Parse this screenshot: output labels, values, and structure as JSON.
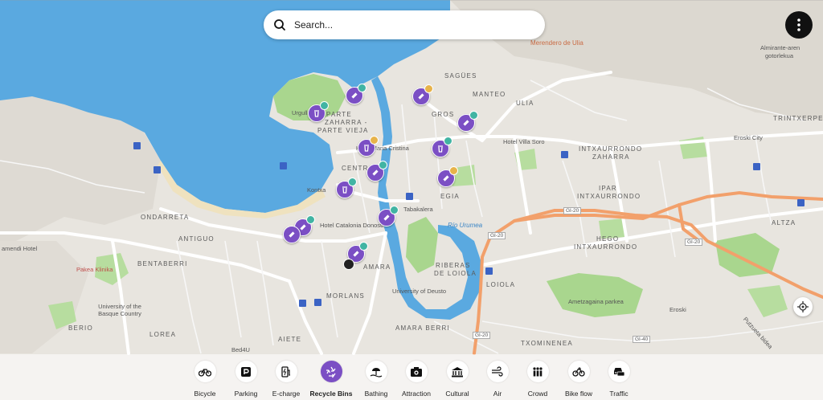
{
  "search": {
    "placeholder": "Search..."
  },
  "map": {
    "labels": {
      "saguees": "SAGÜES",
      "manteo": "MANTEO",
      "ulia": "ULIA",
      "gros": "GROS",
      "parte_zaharra_1": "PARTE",
      "parte_zaharra_2": "ZAHARRA -",
      "parte_zaharra_3": "PARTE VIEJA",
      "urgull": "Urgull",
      "centro": "CENTRO",
      "maria_cristina": "Hotel Maria Cristina",
      "kontxa": "Kontxa",
      "egia": "EGIA",
      "tabakalera": "Tabakalera",
      "catalonia": "Hotel Catalonia Donosti",
      "ondarreta": "ONDARRETA",
      "antiguo": "ANTIGUO",
      "amendi": "amendi Hotel",
      "bentaberri": "BENTABERRI",
      "pakea": "Pakea Klinika",
      "univ_basque": "University of the Basque Country",
      "berio": "BERIO",
      "lorea": "LOREA",
      "bed4u": "Bed4U",
      "aiete": "AIETE",
      "amara": "AMARA",
      "morlans": "MORLANS",
      "amara_berri": "AMARA BERRI",
      "riberas": "RIBERAS",
      "de_loiola": "DE LOIOLA",
      "loiola": "LOIOLA",
      "deusto": "University of Deusto",
      "rio_urumea": "Río Urumea",
      "txominenea": "TXOMINENEA",
      "intxaurrondo_z": "INTXAURRONDO",
      "zaharra": "ZAHARRA",
      "ipar": "IPAR",
      "intx": "INTXAURRONDO",
      "hego": "HEGO",
      "intx2": "INTXAURRONDO",
      "villa_soro": "Hotel Villa Soro",
      "eroski_city": "Eroski City",
      "trintxerpe": "TRINTXERPE",
      "altza": "ALTZA",
      "ametzagaina": "Ametzagaina parkea",
      "eroski": "Eroski",
      "merendero": "Merendero de Ulia",
      "almirante": "Almirante-aren",
      "gotorlekua": "gotorlekua",
      "putzueta": "Putzueta bidea",
      "gi20_a": "GI-20",
      "gi20_b": "GI-20",
      "gi20_c": "GI-20",
      "gi20_d": "GI-20",
      "gi40": "GI-40"
    }
  },
  "categories": [
    {
      "name": "Bicycle",
      "icon": "bicycle-icon"
    },
    {
      "name": "Parking",
      "icon": "parking-icon"
    },
    {
      "name": "E-charge",
      "icon": "charging-station-icon"
    },
    {
      "name": "Recycle Bins",
      "icon": "recycle-icon",
      "active": true
    },
    {
      "name": "Bathing",
      "icon": "beach-icon"
    },
    {
      "name": "Attraction",
      "icon": "camera-icon"
    },
    {
      "name": "Cultural",
      "icon": "museum-icon"
    },
    {
      "name": "Air",
      "icon": "wind-icon"
    },
    {
      "name": "Crowd",
      "icon": "crowd-icon"
    },
    {
      "name": "Bike flow",
      "icon": "bike-flow-icon"
    },
    {
      "name": "Traffic",
      "icon": "traffic-icon"
    }
  ],
  "colors": {
    "accent": "#7b4fc4",
    "sea": "#5aa9e0",
    "park": "#a9d68e",
    "highway": "#f2a06b",
    "status_ok": "#41b4a3",
    "status_warn": "#e7b34a"
  }
}
